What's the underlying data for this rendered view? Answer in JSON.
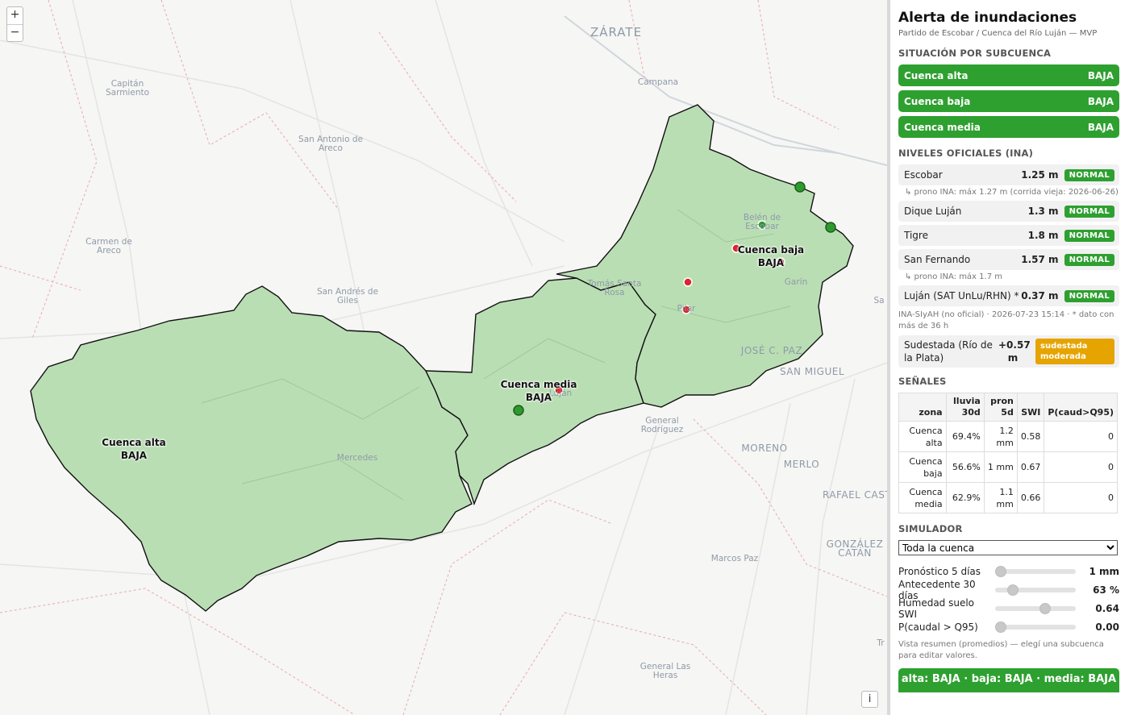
{
  "map": {
    "zoom_in": "+",
    "zoom_out": "−",
    "info": "i",
    "towns": [
      {
        "name": "ZÁRATE",
        "size": "big"
      },
      {
        "name": "Campana",
        "size": "small"
      },
      {
        "name": "Capitán\nSarmiento",
        "size": "small"
      },
      {
        "name": "San Antonio de\nAreco",
        "size": "small"
      },
      {
        "name": "Carmen de\nAreco",
        "size": "small"
      },
      {
        "name": "San Andrés de\nGiles",
        "size": "small"
      },
      {
        "name": "Tomás Santa\nRosa",
        "size": "small"
      },
      {
        "name": "Belén de\nEscobar",
        "size": "small"
      },
      {
        "name": "Garín",
        "size": "small"
      },
      {
        "name": "Pilar",
        "size": "small"
      },
      {
        "name": "JOSÉ C. PAZ",
        "size": "mid"
      },
      {
        "name": "SAN MIGUEL",
        "size": "mid"
      },
      {
        "name": "General\nRodríguez",
        "size": "small"
      },
      {
        "name": "MORENO",
        "size": "mid"
      },
      {
        "name": "MERLO",
        "size": "mid"
      },
      {
        "name": "RAFAEL CASTILLO",
        "size": "mid"
      },
      {
        "name": "GONZÁLEZ\nCATÁN",
        "size": "mid"
      },
      {
        "name": "Mercedes",
        "size": "small"
      },
      {
        "name": "Luján",
        "size": "small"
      },
      {
        "name": "Marcos Paz",
        "size": "small"
      },
      {
        "name": "General Las\nHeras",
        "size": "small"
      },
      {
        "name": "Sa",
        "size": "small"
      },
      {
        "name": "Tr",
        "size": "small"
      }
    ],
    "regions": [
      {
        "name": "Cuenca alta",
        "level": "BAJA"
      },
      {
        "name": "Cuenca media",
        "level": "BAJA"
      },
      {
        "name": "Cuenca baja",
        "level": "BAJA"
      }
    ],
    "colors": {
      "region_fill": "#b6dcb0",
      "station_ok": "#2e9a2e",
      "station_alert": "#d9262c"
    }
  },
  "sidebar": {
    "title": "Alerta de inundaciones",
    "subtitle": "Partido de Escobar / Cuenca del Río Luján — MVP",
    "sec_subcuenca": "SITUACIÓN POR SUBCUENCA",
    "subcuencas": [
      {
        "name": "Cuenca alta",
        "level": "BAJA"
      },
      {
        "name": "Cuenca baja",
        "level": "BAJA"
      },
      {
        "name": "Cuenca media",
        "level": "BAJA"
      }
    ],
    "sec_niveles": "NIVELES OFICIALES (INA)",
    "niveles": [
      {
        "name": "Escobar",
        "value": "1.25 m",
        "status": "NORMAL",
        "note": "↳ prono INA: máx 1.27 m (corrida vieja: 2026-06-26)"
      },
      {
        "name": "Dique Luján",
        "value": "1.3 m",
        "status": "NORMAL",
        "note": ""
      },
      {
        "name": "Tigre",
        "value": "1.8 m",
        "status": "NORMAL",
        "note": ""
      },
      {
        "name": "San Fernando",
        "value": "1.57 m",
        "status": "NORMAL",
        "note": "↳ prono INA: máx 1.7 m"
      },
      {
        "name": "Luján (SAT UnLu/RHN) *",
        "value": "0.37 m",
        "status": "NORMAL",
        "note": ""
      }
    ],
    "source_note": "INA-SIyAH (no oficial) · 2026-07-23 15:14 · * dato con más de 36 h",
    "sudestada": {
      "name": "Sudestada (Río de la Plata)",
      "value": "+0.57 m",
      "status": "sudestada moderada"
    },
    "sec_senales": "SEÑALES",
    "table": {
      "headers": [
        "zona",
        "lluvia 30d",
        "pron 5d",
        "SWI",
        "P(caud>Q95)"
      ],
      "rows": [
        [
          "Cuenca alta",
          "69.4%",
          "1.2 mm",
          "0.58",
          "0"
        ],
        [
          "Cuenca baja",
          "56.6%",
          "1 mm",
          "0.67",
          "0"
        ],
        [
          "Cuenca media",
          "62.9%",
          "1.1 mm",
          "0.66",
          "0"
        ]
      ]
    },
    "sec_simulador": "SIMULADOR",
    "select_value": "Toda la cuenca",
    "sliders": [
      {
        "label": "Pronóstico 5 días",
        "value": "1 mm",
        "fraction": 0.0
      },
      {
        "label": "Antecedente 30 días",
        "value": "63 %",
        "fraction": 0.18
      },
      {
        "label": "Humedad suelo SWI",
        "value": "0.64",
        "fraction": 0.64
      },
      {
        "label": "P(caudal > Q95)",
        "value": "0.00",
        "fraction": 0.0
      }
    ],
    "sim_note": "Vista resumen (promedios) — elegí una subcuenca para editar valores.",
    "summary": "alta: BAJA · baja: BAJA · media: BAJA",
    "colors": {
      "green": "#2ea030",
      "orange": "#e6a400"
    }
  }
}
